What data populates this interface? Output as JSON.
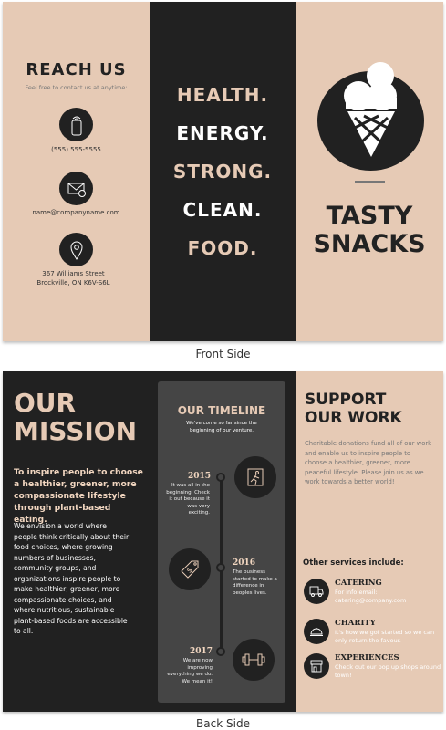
{
  "front": {
    "reach": {
      "title": "REACH US",
      "subtitle": "Feel free to contact us at anytime:",
      "phone": "(555) 555-5555",
      "email": "name@companyname.com",
      "address_line1": "367 Williams Street",
      "address_line2": "Brockville, ON K6V-S6L"
    },
    "words": [
      {
        "text": "HEALTH.",
        "color": "#e6cab5"
      },
      {
        "text": "ENERGY.",
        "color": "#ffffff"
      },
      {
        "text": "STRONG.",
        "color": "#e6cab5"
      },
      {
        "text": "CLEAN.",
        "color": "#ffffff"
      },
      {
        "text": "FOOD.",
        "color": "#e6cab5"
      }
    ],
    "brand": {
      "line1": "TASTY",
      "line2": "SNACKS",
      "icon": "ice-cream-cone-icon"
    },
    "caption": "Front Side"
  },
  "back": {
    "mission": {
      "title1": "OUR",
      "title2": "MISSION",
      "lead": "To inspire people to choose a healthier, greener, more compassionate lifestyle through plant-based eating.",
      "body": "We envision a world where people think critically about their food choices, where growing numbers of businesses, community groups, and organizations inspire people to make healthier, greener, more compassionate choices, and where nutritious, sustainable plant-based foods are accessible to all."
    },
    "timeline": {
      "title": "OUR TIMELINE",
      "subtitle": "We've come so far since the beginning of our venture.",
      "events": [
        {
          "year": "2015",
          "text": "It was all in the beginning. Check it out because it was very exciting.",
          "icon": "exit-running-man-icon"
        },
        {
          "year": "2016",
          "text": "The business started to make a difference in peoples lives.",
          "icon": "price-tag-icon"
        },
        {
          "year": "2017",
          "text": "We are now improving everything we do. We mean it!",
          "icon": "dumbbell-icon"
        }
      ]
    },
    "support": {
      "title1": "SUPPORT",
      "title2": "OUR WORK",
      "body": "Charitable donations fund all of our work and enable us to inspire people to choose a healthier, greener, more peaceful lifestyle. Please join us as we work towards a better world!",
      "services_heading": "Other services include:",
      "services": [
        {
          "title": "CATERING",
          "text": "For info email: catering@company.com",
          "icon": "food-truck-icon"
        },
        {
          "title": "CHARITY",
          "text": "It's how we got started so we can only return the favour.",
          "icon": "cloche-icon"
        },
        {
          "title": "EXPERIENCES",
          "text": "Check out our pop up shops around town!",
          "icon": "storefront-icon"
        }
      ]
    },
    "caption": "Back Side"
  },
  "colors": {
    "beige": "#e6cab5",
    "dark": "#212121",
    "card": "#454545"
  }
}
